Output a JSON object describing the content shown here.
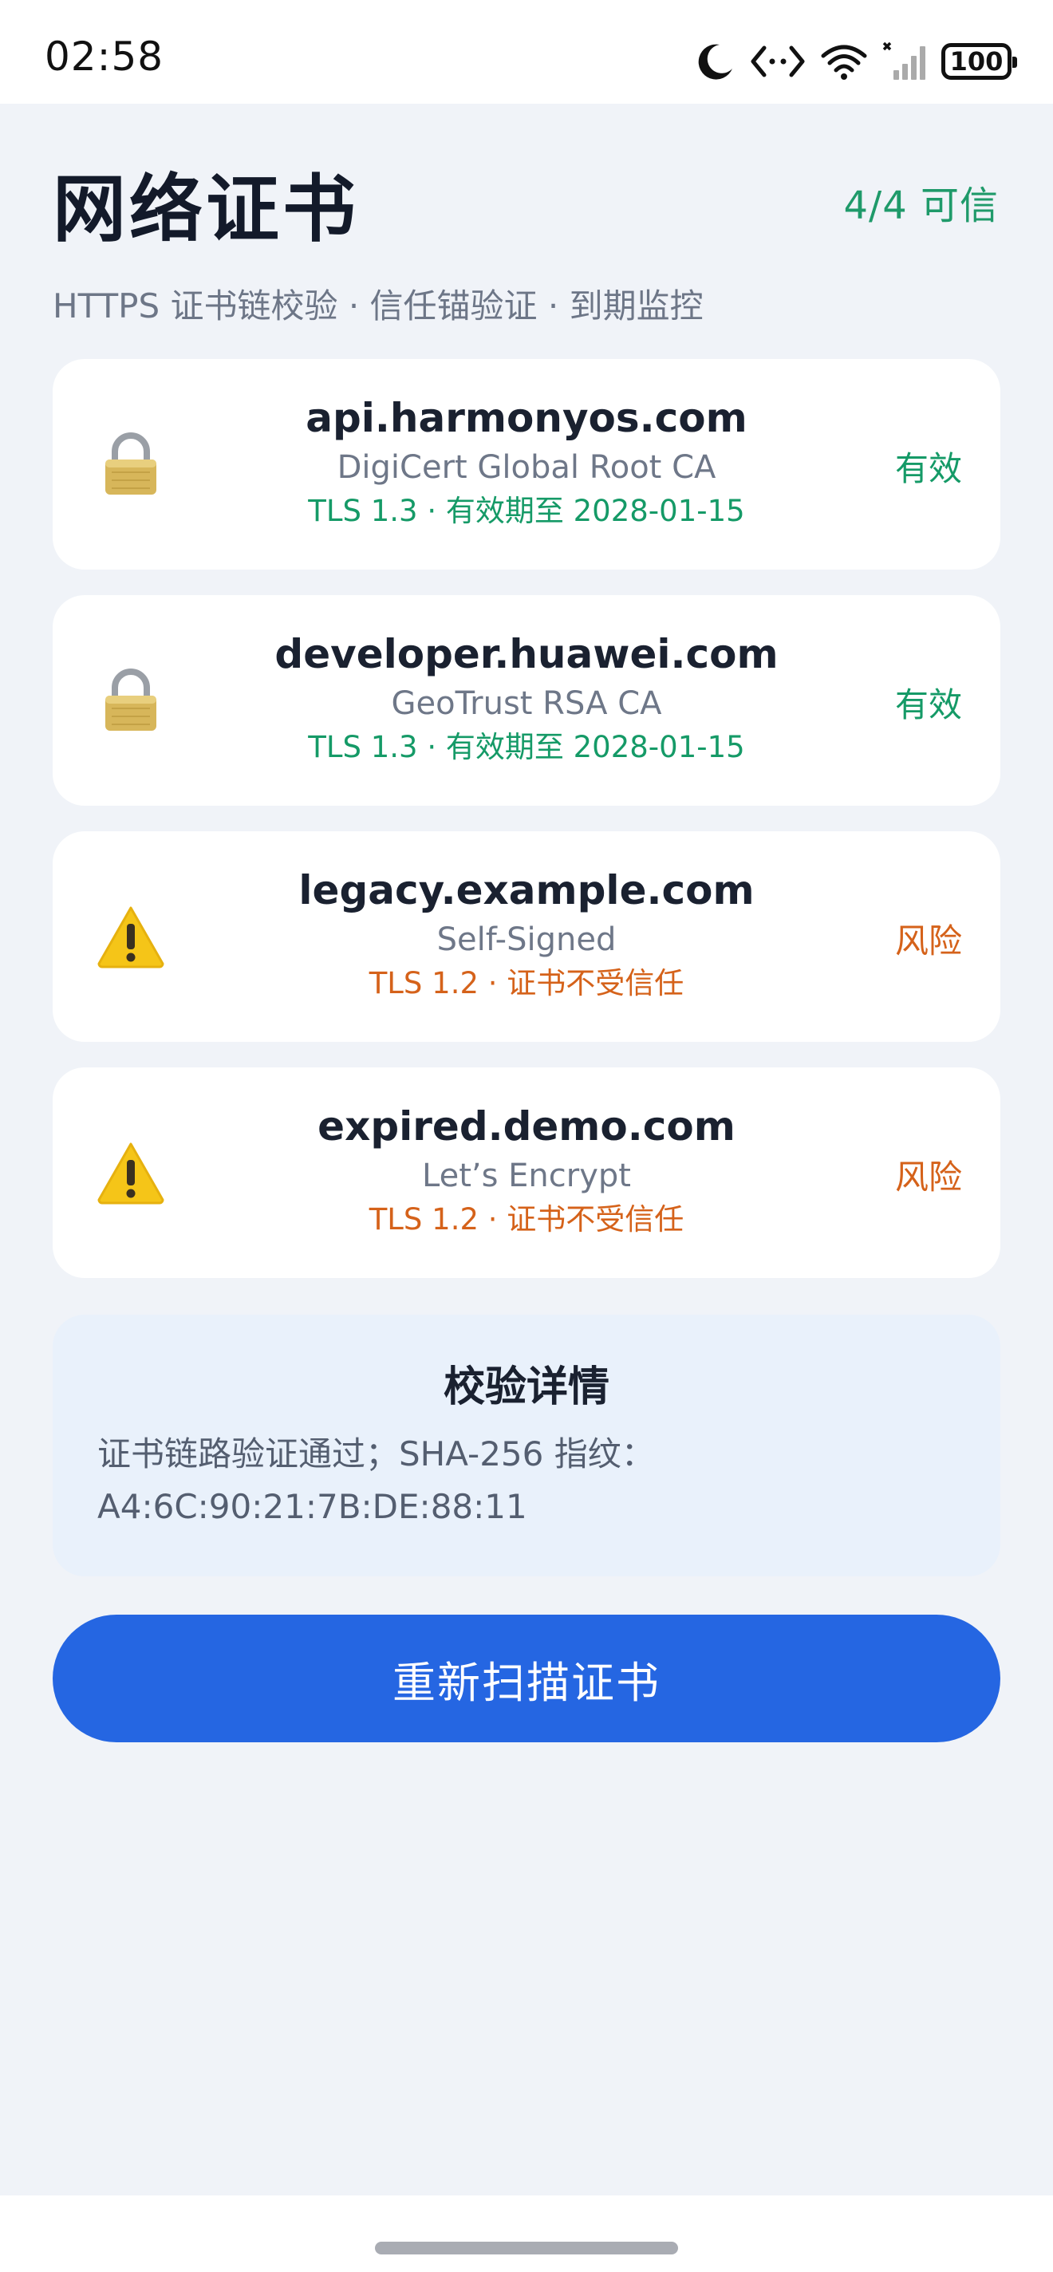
{
  "status_bar": {
    "time": "02:58",
    "battery": "100",
    "icons": [
      "moon-icon",
      "code-icon",
      "wifi-icon",
      "signal-icon",
      "battery-icon"
    ]
  },
  "header": {
    "title": "网络证书",
    "trust_count": "4/4 可信",
    "subtitle": "HTTPS 证书链校验 · 信任锚验证 · 到期监控"
  },
  "certificates": [
    {
      "host": "api.harmonyos.com",
      "issuer": "DigiCert Global Root CA",
      "meta": "TLS 1.3 · 有效期至 2028-01-15",
      "status": "有效",
      "icon": "lock-icon"
    },
    {
      "host": "developer.huawei.com",
      "issuer": "GeoTrust RSA CA",
      "meta": "TLS 1.3 · 有效期至 2028-01-15",
      "status": "有效",
      "icon": "lock-icon"
    },
    {
      "host": "legacy.example.com",
      "issuer": "Self-Signed",
      "meta": "TLS 1.2 · 证书不受信任",
      "status": "风险",
      "icon": "warning-icon"
    },
    {
      "host": "expired.demo.com",
      "issuer": "Let’s Encrypt",
      "meta": "TLS 1.2 · 证书不受信任",
      "status": "风险",
      "icon": "warning-icon"
    }
  ],
  "detail": {
    "title": "校验详情",
    "line1": "证书链路验证通过；SHA-256 指纹：",
    "line2": "A4:6C:90:21:7B:DE:88:11"
  },
  "actions": {
    "rescan_label": "重新扫描证书"
  },
  "colors": {
    "ok": "#159A67",
    "risk": "#D5621A",
    "primary": "#2566E2",
    "background": "#F0F3F8"
  }
}
